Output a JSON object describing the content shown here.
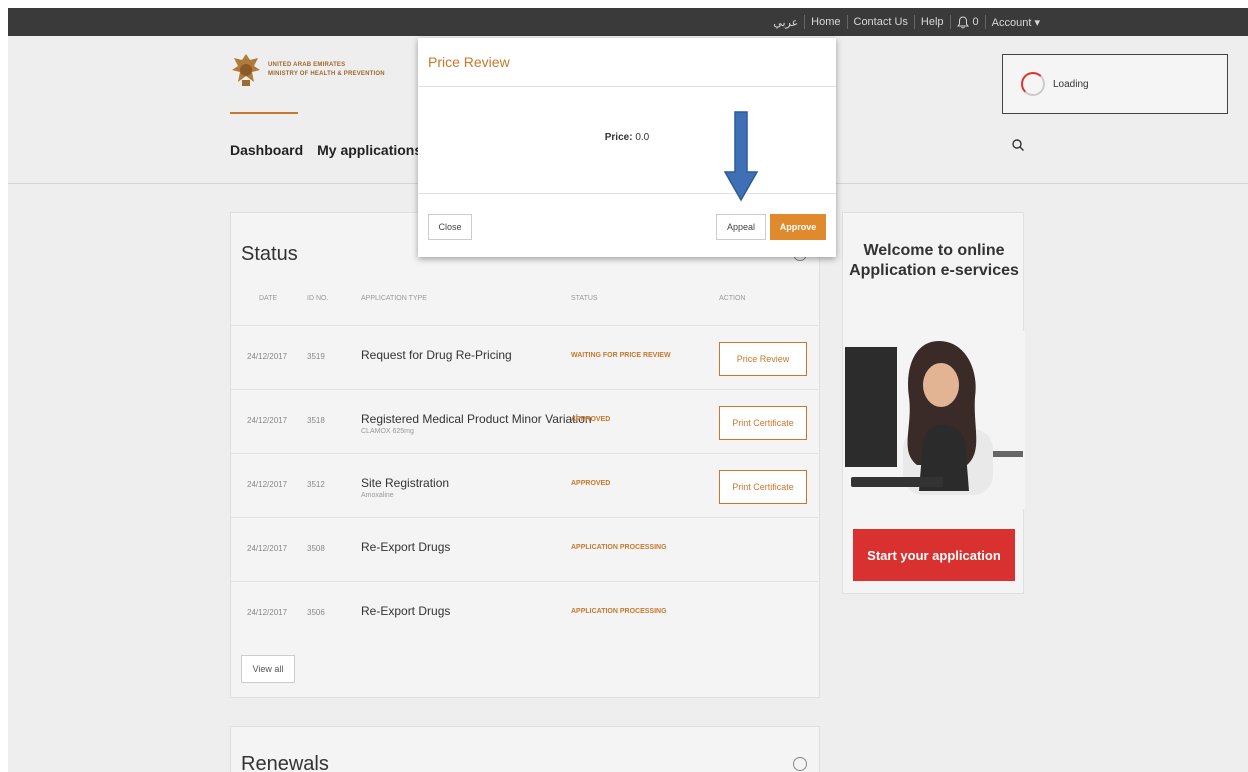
{
  "topbar": {
    "arabic": "عربي",
    "home": "Home",
    "contact": "Contact Us",
    "help": "Help",
    "notifications": "0",
    "account": "Account ▾"
  },
  "header": {
    "logo_line1": "UNITED ARAB EMIRATES",
    "logo_line2": "MINISTRY OF HEALTH & PREVENTION",
    "nav": [
      "Dashboard",
      "My applications"
    ],
    "loading": "Loading"
  },
  "status": {
    "title": "Status",
    "columns": [
      "DATE",
      "ID NO.",
      "APPLICATION TYPE",
      "STATUS",
      "ACTION"
    ],
    "rows": [
      {
        "date": "24/12/2017",
        "id": "3519",
        "type": "Request for Drug Re-Pricing",
        "sub": "",
        "status": "WAITING FOR PRICE REVIEW",
        "action": "Price Review"
      },
      {
        "date": "24/12/2017",
        "id": "3518",
        "type": "Registered Medical Product Minor Variation",
        "sub": "CLAMOX 625mg",
        "status": "APPROVED",
        "action": "Print Certificate"
      },
      {
        "date": "24/12/2017",
        "id": "3512",
        "type": "Site Registration",
        "sub": "Amoxaline",
        "status": "APPROVED",
        "action": "Print Certificate"
      },
      {
        "date": "24/12/2017",
        "id": "3508",
        "type": "Re-Export Drugs",
        "sub": "",
        "status": "APPLICATION PROCESSING",
        "action": ""
      },
      {
        "date": "24/12/2017",
        "id": "3506",
        "type": "Re-Export Drugs",
        "sub": "",
        "status": "APPLICATION PROCESSING",
        "action": ""
      }
    ],
    "view_all": "View all"
  },
  "renewals": {
    "title": "Renewals"
  },
  "welcome": {
    "title": "Welcome to online Application e-services",
    "start": "Start your application"
  },
  "modal": {
    "title": "Price Review",
    "price_label": "Price:",
    "price_value": " 0.0",
    "close": "Close",
    "appeal": "Appeal",
    "approve": "Approve"
  },
  "colors": {
    "accent": "#c8782c",
    "approve": "#e08a2e",
    "start": "#d8312f",
    "arrow": "#3f6fb5"
  }
}
